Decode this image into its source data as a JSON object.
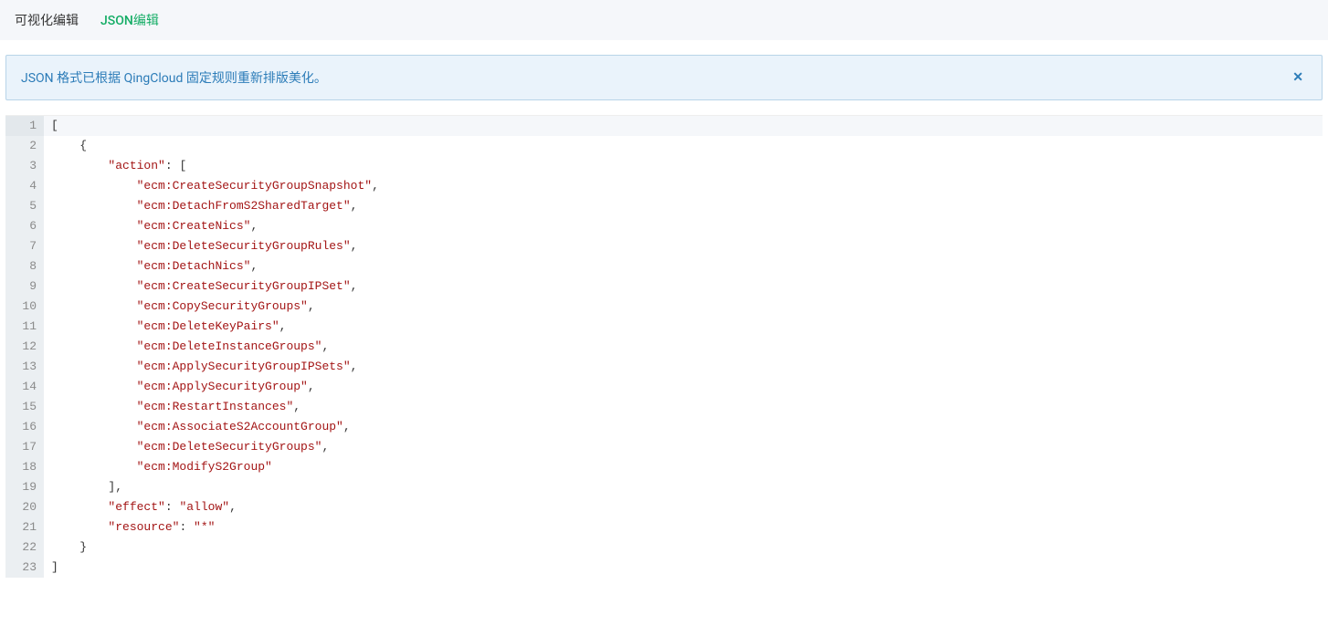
{
  "tabs": {
    "visual": "可视化编辑",
    "json": "JSON编辑"
  },
  "alert": {
    "message": "JSON 格式已根据 QingCloud 固定规则重新排版美化。",
    "close_glyph": "✕"
  },
  "editor": {
    "lines": [
      {
        "num": 1,
        "indent": 0,
        "highlighted": true,
        "tokens": [
          {
            "t": "bracket",
            "v": "["
          }
        ]
      },
      {
        "num": 2,
        "indent": 1,
        "tokens": [
          {
            "t": "punct",
            "v": "{"
          }
        ]
      },
      {
        "num": 3,
        "indent": 2,
        "tokens": [
          {
            "t": "key",
            "v": "\"action\""
          },
          {
            "t": "punct",
            "v": ": ["
          }
        ]
      },
      {
        "num": 4,
        "indent": 3,
        "tokens": [
          {
            "t": "string",
            "v": "\"ecm:CreateSecurityGroupSnapshot\""
          },
          {
            "t": "punct",
            "v": ","
          }
        ]
      },
      {
        "num": 5,
        "indent": 3,
        "tokens": [
          {
            "t": "string",
            "v": "\"ecm:DetachFromS2SharedTarget\""
          },
          {
            "t": "punct",
            "v": ","
          }
        ]
      },
      {
        "num": 6,
        "indent": 3,
        "tokens": [
          {
            "t": "string",
            "v": "\"ecm:CreateNics\""
          },
          {
            "t": "punct",
            "v": ","
          }
        ]
      },
      {
        "num": 7,
        "indent": 3,
        "tokens": [
          {
            "t": "string",
            "v": "\"ecm:DeleteSecurityGroupRules\""
          },
          {
            "t": "punct",
            "v": ","
          }
        ]
      },
      {
        "num": 8,
        "indent": 3,
        "tokens": [
          {
            "t": "string",
            "v": "\"ecm:DetachNics\""
          },
          {
            "t": "punct",
            "v": ","
          }
        ]
      },
      {
        "num": 9,
        "indent": 3,
        "tokens": [
          {
            "t": "string",
            "v": "\"ecm:CreateSecurityGroupIPSet\""
          },
          {
            "t": "punct",
            "v": ","
          }
        ]
      },
      {
        "num": 10,
        "indent": 3,
        "tokens": [
          {
            "t": "string",
            "v": "\"ecm:CopySecurityGroups\""
          },
          {
            "t": "punct",
            "v": ","
          }
        ]
      },
      {
        "num": 11,
        "indent": 3,
        "tokens": [
          {
            "t": "string",
            "v": "\"ecm:DeleteKeyPairs\""
          },
          {
            "t": "punct",
            "v": ","
          }
        ]
      },
      {
        "num": 12,
        "indent": 3,
        "tokens": [
          {
            "t": "string",
            "v": "\"ecm:DeleteInstanceGroups\""
          },
          {
            "t": "punct",
            "v": ","
          }
        ]
      },
      {
        "num": 13,
        "indent": 3,
        "tokens": [
          {
            "t": "string",
            "v": "\"ecm:ApplySecurityGroupIPSets\""
          },
          {
            "t": "punct",
            "v": ","
          }
        ]
      },
      {
        "num": 14,
        "indent": 3,
        "tokens": [
          {
            "t": "string",
            "v": "\"ecm:ApplySecurityGroup\""
          },
          {
            "t": "punct",
            "v": ","
          }
        ]
      },
      {
        "num": 15,
        "indent": 3,
        "tokens": [
          {
            "t": "string",
            "v": "\"ecm:RestartInstances\""
          },
          {
            "t": "punct",
            "v": ","
          }
        ]
      },
      {
        "num": 16,
        "indent": 3,
        "tokens": [
          {
            "t": "string",
            "v": "\"ecm:AssociateS2AccountGroup\""
          },
          {
            "t": "punct",
            "v": ","
          }
        ]
      },
      {
        "num": 17,
        "indent": 3,
        "tokens": [
          {
            "t": "string",
            "v": "\"ecm:DeleteSecurityGroups\""
          },
          {
            "t": "punct",
            "v": ","
          }
        ]
      },
      {
        "num": 18,
        "indent": 3,
        "tokens": [
          {
            "t": "string",
            "v": "\"ecm:ModifyS2Group\""
          }
        ]
      },
      {
        "num": 19,
        "indent": 2,
        "tokens": [
          {
            "t": "punct",
            "v": "],"
          }
        ]
      },
      {
        "num": 20,
        "indent": 2,
        "tokens": [
          {
            "t": "key",
            "v": "\"effect\""
          },
          {
            "t": "punct",
            "v": ": "
          },
          {
            "t": "string",
            "v": "\"allow\""
          },
          {
            "t": "punct",
            "v": ","
          }
        ]
      },
      {
        "num": 21,
        "indent": 2,
        "tokens": [
          {
            "t": "key",
            "v": "\"resource\""
          },
          {
            "t": "punct",
            "v": ": "
          },
          {
            "t": "string",
            "v": "\"*\""
          }
        ]
      },
      {
        "num": 22,
        "indent": 1,
        "tokens": [
          {
            "t": "punct",
            "v": "}"
          }
        ]
      },
      {
        "num": 23,
        "indent": 0,
        "tokens": [
          {
            "t": "bracket",
            "v": "]"
          }
        ]
      }
    ]
  }
}
